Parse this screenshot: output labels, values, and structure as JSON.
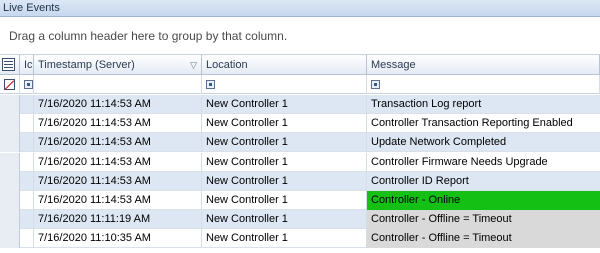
{
  "window": {
    "title": "Live Events"
  },
  "group_panel": {
    "hint": "Drag a column header here to group by that column."
  },
  "columns": {
    "icon": "Ic",
    "timestamp": "Timestamp (Server)",
    "location": "Location",
    "message": "Message"
  },
  "status_colors": {
    "online": "#13c013",
    "offline": "#d9d9d9"
  },
  "rows": [
    {
      "timestamp": "7/16/2020 11:14:53 AM",
      "location": "New Controller   1",
      "message": "Transaction Log report",
      "message_status": "none"
    },
    {
      "timestamp": "7/16/2020 11:14:53 AM",
      "location": "New Controller   1",
      "message": "Controller Transaction Reporting Enabled",
      "message_status": "none"
    },
    {
      "timestamp": "7/16/2020 11:14:53 AM",
      "location": "New Controller   1",
      "message": "Update Network Completed",
      "message_status": "none"
    },
    {
      "timestamp": "7/16/2020 11:14:53 AM",
      "location": "New Controller   1",
      "message": "Controller Firmware Needs Upgrade",
      "message_status": "none"
    },
    {
      "timestamp": "7/16/2020 11:14:53 AM",
      "location": "New Controller   1",
      "message": "Controller ID Report",
      "message_status": "none"
    },
    {
      "timestamp": "7/16/2020 11:14:53 AM",
      "location": "New Controller   1",
      "message": "Controller - Online",
      "message_status": "online"
    },
    {
      "timestamp": "7/16/2020 11:11:19 AM",
      "location": "New Controller   1",
      "message": "Controller - Offline = Timeout",
      "message_status": "offline"
    },
    {
      "timestamp": "7/16/2020 11:10:35 AM",
      "location": "New Controller   1",
      "message": "Controller - Offline = Timeout",
      "message_status": "offline"
    }
  ]
}
